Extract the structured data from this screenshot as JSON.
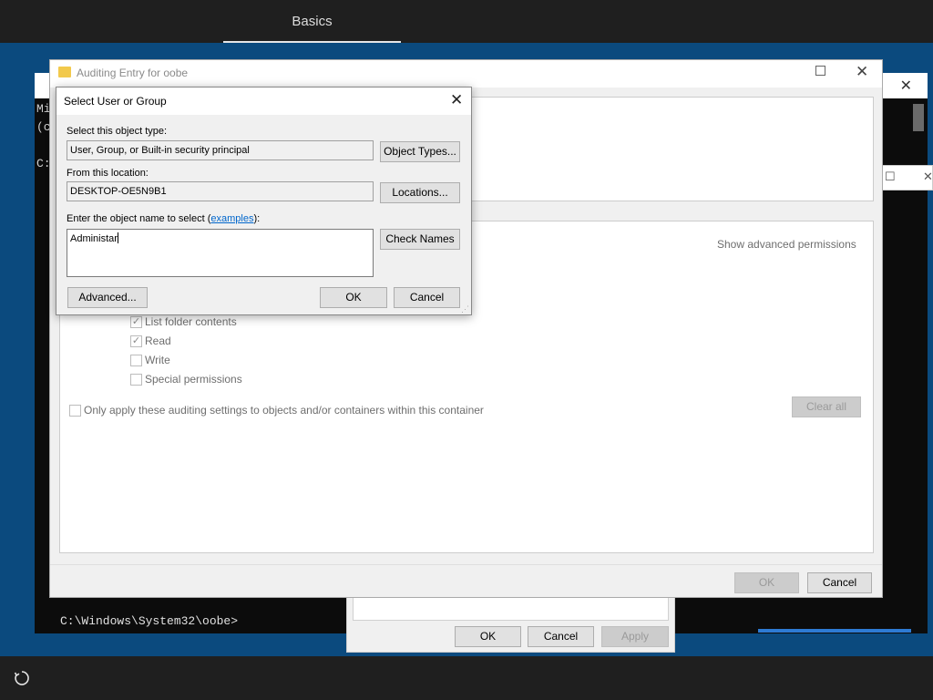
{
  "oobe": {
    "tab_label": "Basics"
  },
  "cmd": {
    "lines": "Mi\n(c\n\nC:",
    "prompt": "C:\\Windows\\System32\\oobe>"
  },
  "audit_window": {
    "title": "Auditing Entry for oobe",
    "show_advanced_label": "Show advanced permissions",
    "permissions": [
      {
        "label": "List folder contents",
        "checked": true
      },
      {
        "label": "Read",
        "checked": true
      },
      {
        "label": "Write",
        "checked": false
      },
      {
        "label": "Special permissions",
        "checked": false
      }
    ],
    "apply_only_label": "Only apply these auditing settings to objects and/or containers within this container",
    "clear_all_label": "Clear all",
    "ok_label": "OK",
    "cancel_label": "Cancel"
  },
  "security_dialog": {
    "ok_label": "OK",
    "cancel_label": "Cancel",
    "apply_label": "Apply"
  },
  "select_dialog": {
    "title": "Select User or Group",
    "object_type_label": "Select this object type:",
    "object_type_value": "User, Group, or Built-in security principal",
    "object_types_button": "Object Types...",
    "location_label": "From this location:",
    "location_value": "DESKTOP-OE5N9B1",
    "locations_button": "Locations...",
    "enter_name_label": "Enter the object name to select (",
    "examples_link": "examples",
    "enter_name_suffix": "):",
    "object_name_value": "Administar",
    "check_names_button": "Check Names",
    "advanced_button": "Advanced...",
    "ok_button": "OK",
    "cancel_button": "Cancel"
  },
  "icons": {
    "accessibility": "accessibility-icon",
    "close": "close-icon",
    "maximize": "maximize-icon",
    "folder": "folder-icon"
  },
  "colors": {
    "desktop": "#0b4a7e",
    "bar": "#1f1f1f",
    "link": "#0066cc",
    "focus": "#0078d7"
  }
}
